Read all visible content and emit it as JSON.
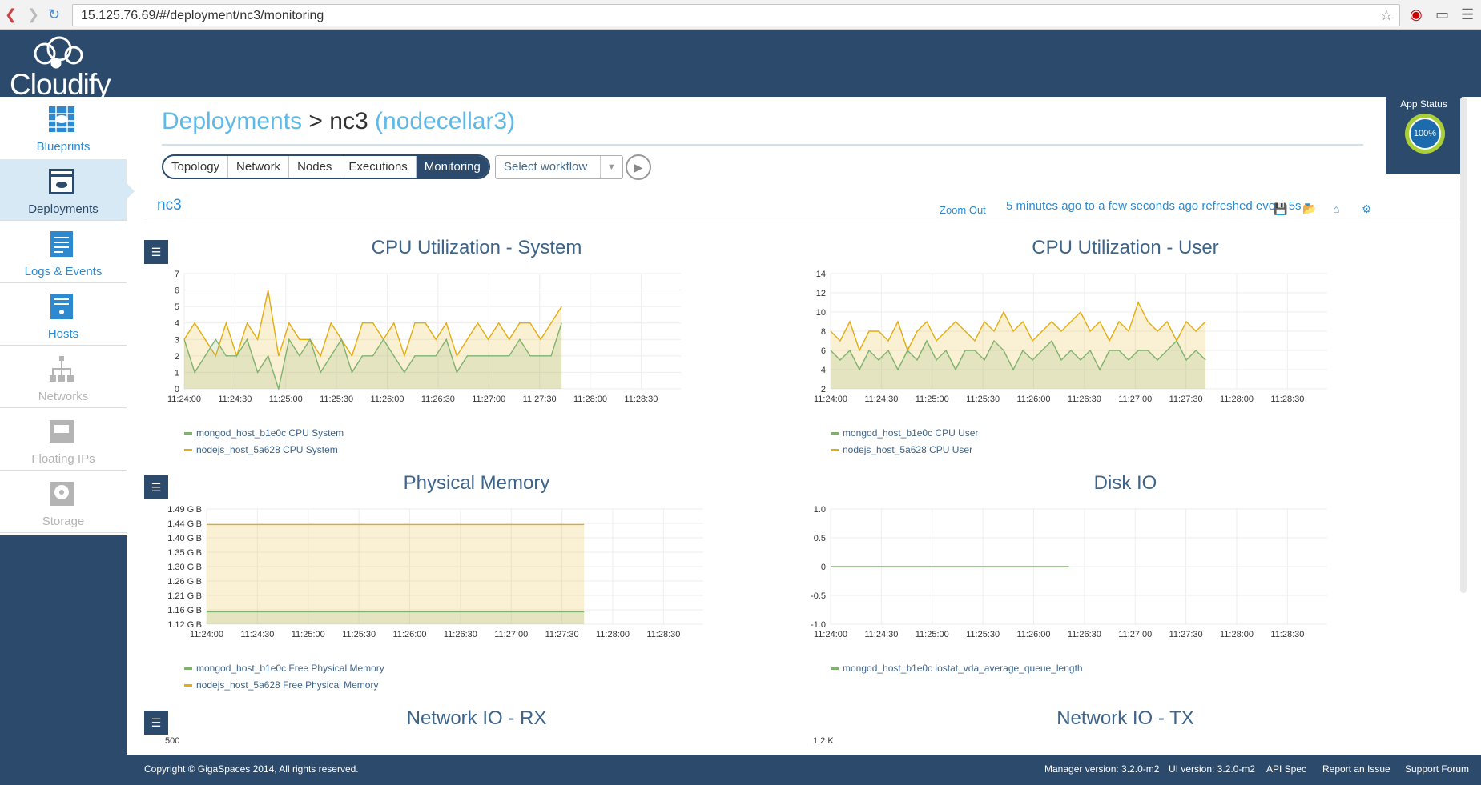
{
  "browser": {
    "url": "15.125.76.69/#/deployment/nc3/monitoring"
  },
  "brand": {
    "name": "Cloudify"
  },
  "sidebar": {
    "items": [
      {
        "label": "Blueprints",
        "icon": "blueprints-icon",
        "active": false,
        "disabled": false
      },
      {
        "label": "Deployments",
        "icon": "deployments-icon",
        "active": true,
        "disabled": false
      },
      {
        "label": "Logs & Events",
        "icon": "logs-icon",
        "active": false,
        "disabled": false
      },
      {
        "label": "Hosts",
        "icon": "hosts-icon",
        "active": false,
        "disabled": false
      },
      {
        "label": "Networks",
        "icon": "networks-icon",
        "active": false,
        "disabled": true
      },
      {
        "label": "Floating IPs",
        "icon": "floating-ips-icon",
        "active": false,
        "disabled": true
      },
      {
        "label": "Storage",
        "icon": "storage-icon",
        "active": false,
        "disabled": true
      }
    ]
  },
  "header": {
    "breadcrumb_root": "Deployments",
    "separator": ">",
    "current": "nc3",
    "blueprint": "(nodecellar3)"
  },
  "tabs": [
    {
      "label": "Topology",
      "active": false
    },
    {
      "label": "Network",
      "active": false
    },
    {
      "label": "Nodes",
      "active": false
    },
    {
      "label": "Executions",
      "active": false
    },
    {
      "label": "Monitoring",
      "active": true
    }
  ],
  "workflow": {
    "placeholder": "Select workflow"
  },
  "app_status": {
    "label": "App Status",
    "value": "100%"
  },
  "dashboard": {
    "title": "nc3",
    "zoom_out": "Zoom Out",
    "time_range": "5 minutes ago to a few seconds ago refreshed every 5s"
  },
  "colors": {
    "green": "#7eb26d",
    "orange": "#e5ac0e",
    "navy": "#2c4a6b",
    "link": "#2e8ad0"
  },
  "chart_data": [
    {
      "type": "area",
      "title": "CPU Utilization - System",
      "x": [
        "11:24:00",
        "11:24:30",
        "11:25:00",
        "11:25:30",
        "11:26:00",
        "11:26:30",
        "11:27:00",
        "11:27:30",
        "11:28:00",
        "11:28:30"
      ],
      "ylim": [
        0,
        7
      ],
      "yticks": [
        "0",
        "1",
        "2",
        "3",
        "4",
        "5",
        "6",
        "7"
      ],
      "series": [
        {
          "name": "mongod_host_b1e0c CPU System",
          "color": "#7eb26d",
          "values": [
            3,
            1,
            2,
            3,
            2,
            2,
            3,
            1,
            2,
            0,
            3,
            2,
            3,
            1,
            2,
            3,
            1,
            2,
            2,
            3,
            2,
            1,
            2,
            2,
            2,
            3,
            1,
            2,
            2,
            2,
            2,
            2,
            3,
            2,
            2,
            2,
            4
          ]
        },
        {
          "name": "nodejs_host_5a628 CPU System",
          "color": "#e5ac0e",
          "values": [
            3,
            4,
            3,
            2,
            4,
            2,
            4,
            3,
            6,
            2,
            4,
            3,
            3,
            2,
            4,
            3,
            2,
            4,
            4,
            3,
            4,
            2,
            4,
            4,
            3,
            4,
            2,
            3,
            4,
            3,
            4,
            3,
            4,
            4,
            3,
            4,
            5
          ]
        }
      ]
    },
    {
      "type": "area",
      "title": "CPU Utilization - User",
      "x": [
        "11:24:00",
        "11:24:30",
        "11:25:00",
        "11:25:30",
        "11:26:00",
        "11:26:30",
        "11:27:00",
        "11:27:30",
        "11:28:00",
        "11:28:30"
      ],
      "ylim": [
        2,
        14
      ],
      "yticks": [
        "2",
        "4",
        "6",
        "8",
        "10",
        "12",
        "14"
      ],
      "series": [
        {
          "name": "mongod_host_b1e0c CPU User",
          "color": "#7eb26d",
          "values": [
            6,
            5,
            6,
            4,
            6,
            5,
            6,
            4,
            6,
            5,
            7,
            5,
            6,
            4,
            6,
            6,
            5,
            7,
            6,
            4,
            6,
            5,
            6,
            7,
            5,
            6,
            5,
            6,
            4,
            6,
            6,
            5,
            6,
            6,
            5,
            6,
            7,
            5,
            6,
            5
          ]
        },
        {
          "name": "nodejs_host_5a628 CPU User",
          "color": "#e5ac0e",
          "values": [
            8,
            7,
            9,
            6,
            8,
            8,
            7,
            9,
            6,
            8,
            9,
            7,
            8,
            9,
            8,
            7,
            9,
            8,
            10,
            8,
            9,
            7,
            8,
            9,
            8,
            9,
            10,
            8,
            9,
            7,
            9,
            8,
            11,
            9,
            8,
            9,
            7,
            9,
            8,
            9
          ]
        }
      ]
    },
    {
      "type": "area",
      "title": "Physical Memory",
      "x": [
        "11:24:00",
        "11:24:30",
        "11:25:00",
        "11:25:30",
        "11:26:00",
        "11:26:30",
        "11:27:00",
        "11:27:30",
        "11:28:00",
        "11:28:30"
      ],
      "ylim": [
        1.12,
        1.49
      ],
      "yticks": [
        "1.12 GiB",
        "1.16 GiB",
        "1.21 GiB",
        "1.26 GiB",
        "1.30 GiB",
        "1.35 GiB",
        "1.40 GiB",
        "1.44 GiB",
        "1.49 GiB"
      ],
      "series": [
        {
          "name": "mongod_host_b1e0c Free Physical Memory",
          "color": "#7eb26d",
          "values": [
            1.16,
            1.16
          ]
        },
        {
          "name": "nodejs_host_5a628 Free Physical Memory",
          "color": "#e5ac0e",
          "values": [
            1.44,
            1.44
          ]
        }
      ]
    },
    {
      "type": "line",
      "title": "Disk IO",
      "x": [
        "11:24:00",
        "11:24:30",
        "11:25:00",
        "11:25:30",
        "11:26:00",
        "11:26:30",
        "11:27:00",
        "11:27:30",
        "11:28:00",
        "11:28:30"
      ],
      "ylim": [
        -1.0,
        1.0
      ],
      "yticks": [
        "-1.0",
        "-0.5",
        "0",
        "0.5",
        "1.0"
      ],
      "series": [
        {
          "name": "mongod_host_b1e0c iostat_vda_average_queue_length",
          "color": "#7eb26d",
          "values": [
            0,
            0
          ]
        }
      ]
    },
    {
      "type": "area",
      "title": "Network IO - RX",
      "yticks": [
        "500"
      ],
      "series": []
    },
    {
      "type": "area",
      "title": "Network IO - TX",
      "yticks": [
        "1.2 K"
      ],
      "series": []
    }
  ],
  "footer": {
    "copyright": "Copyright © GigaSpaces 2014, All rights reserved.",
    "manager_version": "Manager version: 3.2.0-m2",
    "ui_version": "UI version: 3.2.0-m2",
    "api_spec": "API Spec",
    "report_issue": "Report an Issue",
    "support_forum": "Support Forum"
  }
}
